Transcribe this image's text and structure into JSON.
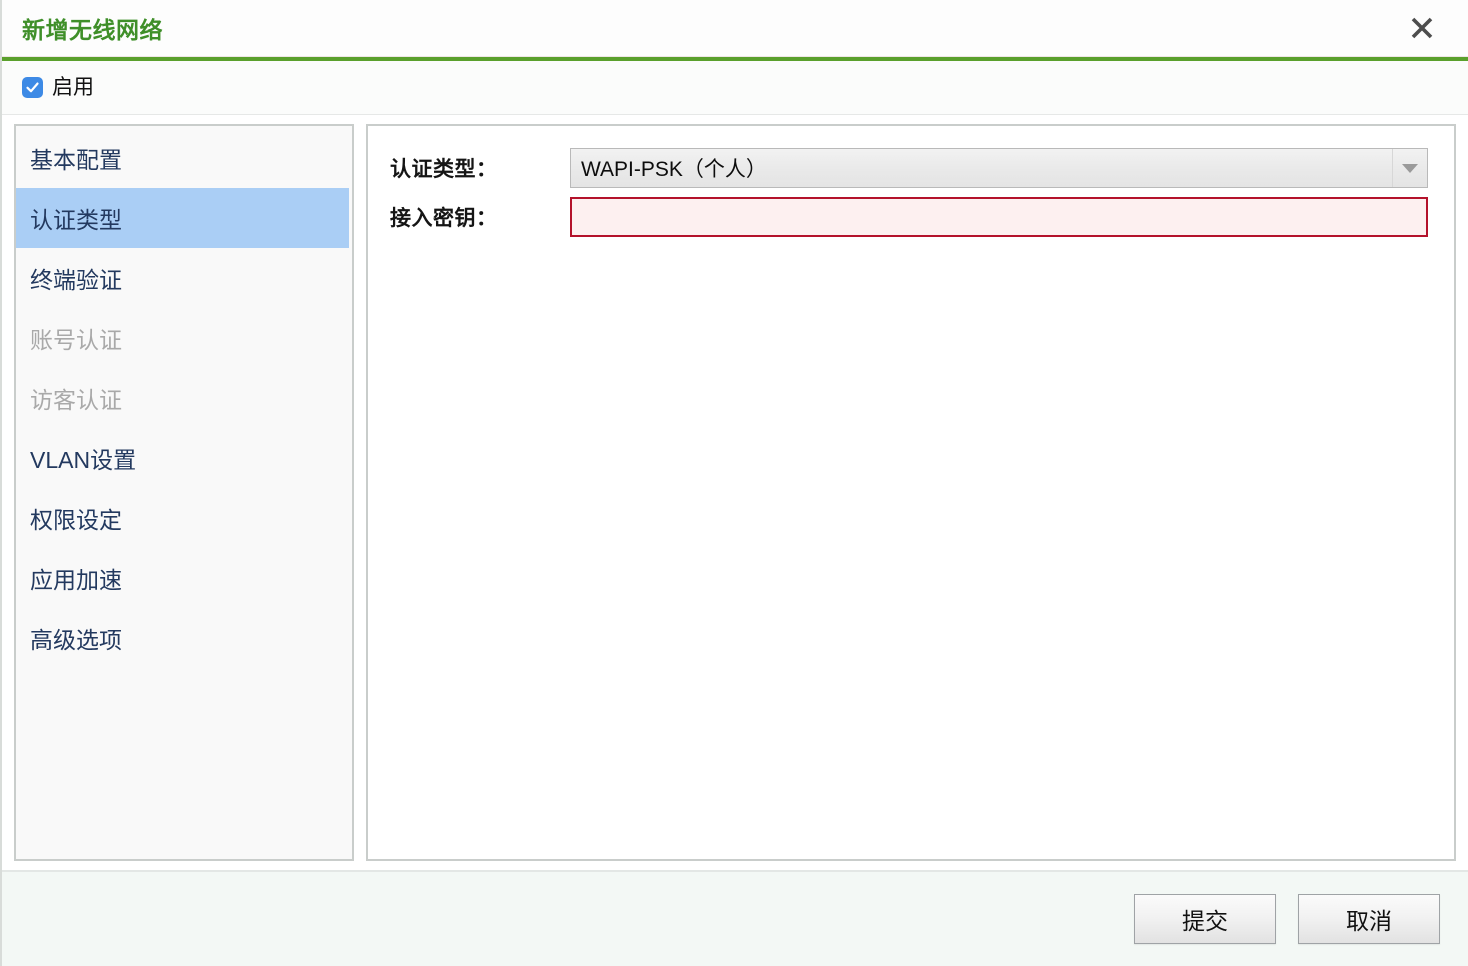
{
  "window": {
    "title": "新增无线网络",
    "close_icon": "close-icon"
  },
  "enable": {
    "label": "启用",
    "checked": true,
    "check_icon": "check-icon"
  },
  "sidebar": {
    "items": [
      {
        "label": "基本配置",
        "state": "normal"
      },
      {
        "label": "认证类型",
        "state": "selected"
      },
      {
        "label": "终端验证",
        "state": "normal"
      },
      {
        "label": "账号认证",
        "state": "disabled"
      },
      {
        "label": "访客认证",
        "state": "disabled"
      },
      {
        "label": "VLAN设置",
        "state": "normal"
      },
      {
        "label": "权限设定",
        "state": "normal"
      },
      {
        "label": "应用加速",
        "state": "normal"
      },
      {
        "label": "高级选项",
        "state": "normal"
      }
    ]
  },
  "form": {
    "auth_type": {
      "label": "认证类型：",
      "value": "WAPI-PSK（个人）",
      "arrow_icon": "chevron-down-icon"
    },
    "psk": {
      "label": "接入密钥：",
      "value": "",
      "placeholder": ""
    }
  },
  "footer": {
    "submit_label": "提交",
    "cancel_label": "取消"
  },
  "colors": {
    "title_green": "#3f8f29",
    "rule_green": "#5aa02c",
    "selection_blue": "#aacef5",
    "sidebar_text": "#23395f",
    "sidebar_disabled": "#a9a9a9",
    "error_border": "#b4122b",
    "error_fill": "#fdf0f0",
    "checkbox_blue": "#3d8ae5"
  }
}
